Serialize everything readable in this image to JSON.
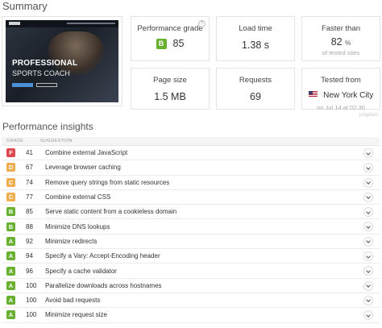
{
  "summary_title": "Summary",
  "thumbnail": {
    "headline": "PROFESSIONAL",
    "subheadline": "SPORTS COACH"
  },
  "metrics": {
    "grade": {
      "label": "Performance grade",
      "letter": "B",
      "value": "85",
      "color": "#68b02f"
    },
    "load_time": {
      "label": "Load time",
      "value": "1.38 s"
    },
    "faster_than": {
      "label": "Faster than",
      "value": "82",
      "unit": "%",
      "sub": "of tested sites"
    },
    "page_size": {
      "label": "Page size",
      "value": "1.5 MB"
    },
    "requests": {
      "label": "Requests",
      "value": "69"
    },
    "tested_from": {
      "label": "Tested from",
      "city": "New York City",
      "sub": "on Jul 14 at 02:30"
    }
  },
  "pingdom_mark": "pingdom",
  "insights_title": "Performance insights",
  "table": {
    "col_grade": "GRADE",
    "col_suggestion": "SUGGESTION",
    "rows": [
      {
        "letter": "F",
        "score": "41",
        "suggestion": "Combine external JavaScript",
        "color": "#e0474c"
      },
      {
        "letter": "D",
        "score": "67",
        "suggestion": "Leverage browser caching",
        "color": "#f0ad4e"
      },
      {
        "letter": "C",
        "score": "74",
        "suggestion": "Remove query strings from static resources",
        "color": "#f0ad4e"
      },
      {
        "letter": "C",
        "score": "77",
        "suggestion": "Combine external CSS",
        "color": "#f0ad4e"
      },
      {
        "letter": "B",
        "score": "85",
        "suggestion": "Serve static content from a cookieless domain",
        "color": "#68b02f"
      },
      {
        "letter": "B",
        "score": "88",
        "suggestion": "Minimize DNS lookups",
        "color": "#68b02f"
      },
      {
        "letter": "A",
        "score": "92",
        "suggestion": "Minimize redirects",
        "color": "#68b02f"
      },
      {
        "letter": "A",
        "score": "94",
        "suggestion": "Specify a Vary: Accept-Encoding header",
        "color": "#68b02f"
      },
      {
        "letter": "A",
        "score": "96",
        "suggestion": "Specify a cache validator",
        "color": "#68b02f"
      },
      {
        "letter": "A",
        "score": "100",
        "suggestion": "Parallelize downloads across hostnames",
        "color": "#68b02f"
      },
      {
        "letter": "A",
        "score": "100",
        "suggestion": "Avoid bad requests",
        "color": "#68b02f"
      },
      {
        "letter": "A",
        "score": "100",
        "suggestion": "Minimize request size",
        "color": "#68b02f"
      }
    ]
  }
}
